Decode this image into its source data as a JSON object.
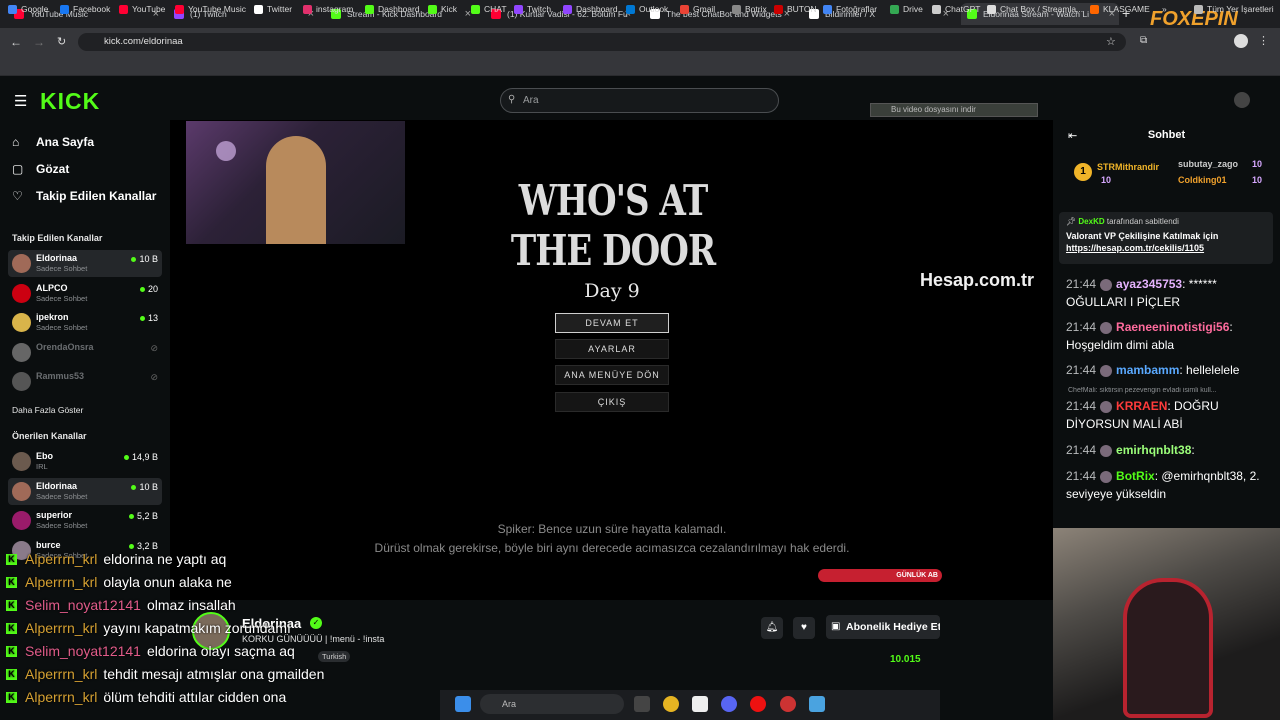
{
  "browser": {
    "tabs": [
      {
        "label": "YouTube Music",
        "color": "#ff0033"
      },
      {
        "label": "(1) Twitch",
        "color": "#9146ff"
      },
      {
        "label": "Stream - Kick Dashboard",
        "color": "#53fc18"
      },
      {
        "label": "(1) Kurtlar Vadisi - 62. Bölüm Fu",
        "color": "#ff0033"
      },
      {
        "label": "The best ChatBot and Widgets",
        "color": "#ffffff"
      },
      {
        "label": "Bildirimler / X",
        "color": "#ffffff"
      },
      {
        "label": "Eldorinaa Stream - Watch Li",
        "color": "#53fc18"
      }
    ],
    "url": "kick.com/eldorinaa",
    "bookmarks": [
      "Google",
      "Facebook",
      "YouTube",
      "YouTube Music",
      "Twitter",
      "instagram",
      "Dashboard",
      "Kick",
      "CHAT",
      "Twitch",
      "Dashboard",
      "Outlook",
      "Gmail",
      "Botrix",
      "BUTON",
      "Fotoğraflar",
      "Drive",
      "ChatGPT",
      "Chat Box / Streamla...",
      "KLASGAME"
    ],
    "all_bookmarks": "Tüm Yer İşaretleri"
  },
  "watermark": "FOXEPIN",
  "kick": {
    "logo": "KICK",
    "search_placeholder": "Ara",
    "download_bar": "Bu video dosyasını indir",
    "nav": [
      "Ana Sayfa",
      "Gözat",
      "Takip Edilen Kanallar"
    ],
    "followed_head": "Takip Edilen Kanallar",
    "followed": [
      {
        "name": "Eldorinaa",
        "sub": "Sadece Sohbet",
        "viewers": "10 B",
        "live": true
      },
      {
        "name": "ALPCO",
        "sub": "Sadece Sohbet",
        "viewers": "20",
        "live": true
      },
      {
        "name": "ipekron",
        "sub": "Sadece Sohbet",
        "viewers": "13",
        "live": true
      },
      {
        "name": "OrendaOnsra",
        "sub": "",
        "viewers": "",
        "live": false
      },
      {
        "name": "Rammus53",
        "sub": "",
        "viewers": "",
        "live": false
      }
    ],
    "show_more": "Daha Fazla Göster",
    "recommended_head": "Önerilen Kanallar",
    "recommended": [
      {
        "name": "Ebo",
        "sub": "IRL",
        "viewers": "14,9 B"
      },
      {
        "name": "Eldorinaa",
        "sub": "Sadece Sohbet",
        "viewers": "10 B"
      },
      {
        "name": "superior",
        "sub": "Sadece Sohbet",
        "viewers": "5,2 B"
      },
      {
        "name": "burce",
        "sub": "Sadece Sohbet",
        "viewers": "3,2 B"
      }
    ]
  },
  "game": {
    "title": "WHO'S AT THE DOOR",
    "day": "Day 9",
    "menu": [
      "DEVAM ET",
      "AYARLAR",
      "ANA MENÜYE DÖN",
      "ÇIKIŞ"
    ],
    "sponsor": "Hesap.com.tr",
    "subtitle1": "Spiker: Bence uzun süre hayatta kalamadı.",
    "subtitle2": "Dürüst olmak gerekirse, böyle biri aynı derecede acımasızca cezalandırılmayı hak ederdi.",
    "daily_goal": "GÜNLÜK AB"
  },
  "channel": {
    "name": "Eldorinaa",
    "title": "KORKU GÜNÜÜÜÜ | !menü - !insta",
    "tag": "Turkish",
    "subscribe": "Abonelik Hediye Et",
    "viewers": "10.015"
  },
  "overlay_chat": [
    {
      "user": "Alperrrn_krl",
      "msg": "eldorina ne yaptı aq",
      "pink": false
    },
    {
      "user": "Alperrrn_krl",
      "msg": "olayla onun alaka ne",
      "pink": false
    },
    {
      "user": "Selim_noyat12141",
      "msg": "olmaz insallah",
      "pink": true
    },
    {
      "user": "Alperrrn_krl",
      "msg": "yayını kapatmakım zorundamı",
      "pink": false
    },
    {
      "user": "Selim_noyat12141",
      "msg": "eldorina olayı saçma aq",
      "pink": true
    },
    {
      "user": "Alperrrn_krl",
      "msg": "tehdit mesajı atmışlar ona gmailden",
      "pink": false
    },
    {
      "user": "Alperrrn_krl",
      "msg": "ölüm tehditi attılar cidden ona",
      "pink": false
    }
  ],
  "taskbar": {
    "search": "Ara"
  },
  "chat": {
    "title": "Sohbet",
    "gifters": [
      {
        "rank": "1",
        "name": "STRMithrandir",
        "count": "10"
      },
      {
        "name": "subutay_zago",
        "count": "10"
      },
      {
        "name": "Coldking01",
        "count": "10"
      }
    ],
    "pinned_by": "DexKD",
    "pinned_suffix": "tarafından sabitlendi",
    "pinned_text": "Valorant VP Çekilişine Katılmak için",
    "pinned_link": "https://hesap.com.tr/cekilis/1105",
    "messages": [
      {
        "time": "21:44",
        "user": "ayaz345753",
        "color": "#e6b3ff",
        "text": ": ****** OĞULLARI I PİÇLER"
      },
      {
        "time": "21:44",
        "user": "Raeneeninotistigi56",
        "color": "#ff6b9d",
        "text": ": Hoşgeldim dimi abla"
      },
      {
        "time": "21:44",
        "user": "mambamm",
        "color": "#5aa9ff",
        "text": ": hellelelele"
      },
      {
        "time": "21:44",
        "user": "KRRAEN",
        "color": "#ff3b3b",
        "text": ": DOĞRU DİYORSUN MALİ ABİ"
      },
      {
        "time": "21:44",
        "user": "emirhqnblt38",
        "color": "#9cff7a",
        "text": ":"
      },
      {
        "time": "21:44",
        "user": "BotRix",
        "color": "#53fc18",
        "text": ": @emirhqnblt38, 2. seviyeye yükseldin"
      }
    ],
    "reply_preview": "ChefMali: siktirsin pezevengin evladi isimli kull..."
  }
}
